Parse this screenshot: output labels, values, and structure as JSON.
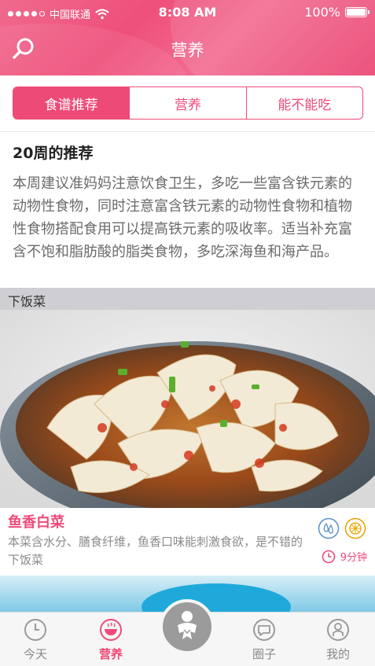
{
  "status_bar": {
    "carrier": "中国联通",
    "time": "8:08 AM",
    "battery": "100%"
  },
  "header": {
    "title": "营养"
  },
  "tabs": [
    {
      "label": "食谱推荐",
      "active": true
    },
    {
      "label": "营养",
      "active": false
    },
    {
      "label": "能不能吃",
      "active": false
    }
  ],
  "intro": {
    "title": "20周的推荐",
    "body": "本周建议准妈妈注意饮食卫生，多吃一些富含铁元素的动物性食物，同时注意富含铁元素的动物性食物和植物性食物搭配食用可以提高铁元素的吸收率。适当补充富含不饱和脂肪酸的脂类食物，多吃深海鱼和海产品。"
  },
  "section": {
    "label": "下饭菜"
  },
  "recipe": {
    "name": "鱼香白菜",
    "description": "本菜含水分、膳食纤维，鱼香口味能刺激食欲，是不错的下饭菜",
    "time": "9分钟"
  },
  "bottom_nav": [
    {
      "label": "今天",
      "icon": "clock-icon",
      "active": false
    },
    {
      "label": "营养",
      "icon": "bowl-icon",
      "active": true
    },
    {
      "label": "圈子",
      "icon": "chat-bubble-icon",
      "active": false
    },
    {
      "label": "我的",
      "icon": "profile-icon",
      "active": false
    }
  ],
  "colors": {
    "accent": "#ee4a78",
    "inactive": "#8a8a8a"
  }
}
